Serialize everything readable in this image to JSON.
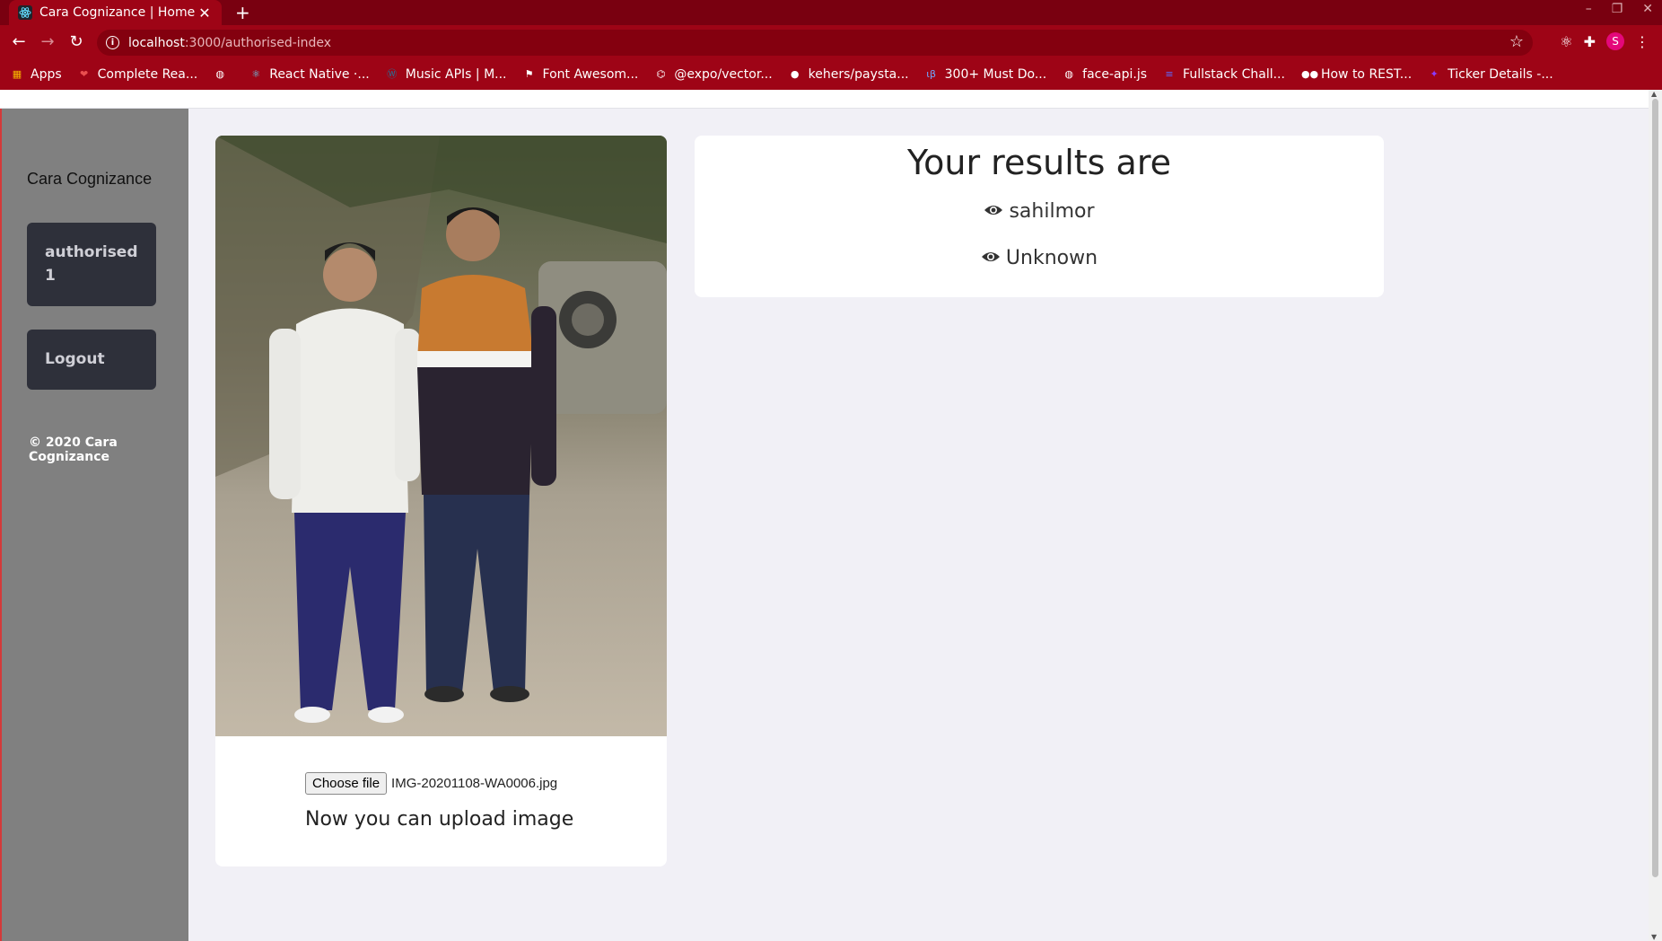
{
  "browser": {
    "tab_title": "Cara Cognizance | Home",
    "url_host": "localhost",
    "url_path": ":3000/authorised-index",
    "profile_initial": "S",
    "bookmarks": [
      {
        "label": "Apps",
        "icon": "apps-grid-icon",
        "color": "#f4b400"
      },
      {
        "label": "Complete Rea...",
        "icon": "bookmark-icon",
        "color": "#e94f4f"
      },
      {
        "label": "",
        "icon": "globe-icon",
        "color": "#ffffff"
      },
      {
        "label": "React Native ·...",
        "icon": "react-icon",
        "color": "#61dafb"
      },
      {
        "label": "Music APIs | M...",
        "icon": "wordpress-icon",
        "color": "#21759b"
      },
      {
        "label": "Font Awesom...",
        "icon": "flag-icon",
        "color": "#ffffff"
      },
      {
        "label": "@expo/vector...",
        "icon": "expo-icon",
        "color": "#ffffff"
      },
      {
        "label": "kehers/paysta...",
        "icon": "github-icon",
        "color": "#ffffff"
      },
      {
        "label": "300+ Must Do...",
        "icon": "ib-icon",
        "color": "#6fa8ff"
      },
      {
        "label": "face-api.js",
        "icon": "globe-icon",
        "color": "#ffffff"
      },
      {
        "label": "Fullstack Chall...",
        "icon": "doc-icon",
        "color": "#5b6bff"
      },
      {
        "label": "How to REST...",
        "icon": "medium-icon",
        "color": "#ffffff"
      },
      {
        "label": "Ticker Details -...",
        "icon": "bulb-icon",
        "color": "#8a3cff"
      }
    ]
  },
  "sidebar": {
    "brand": "Cara Cognizance",
    "auth_button": "authorised 1",
    "logout_button": "Logout",
    "copyright": "© 2020 Cara Cognizance"
  },
  "upload": {
    "choose_label": "Choose file",
    "file_name": "IMG-20201108-WA0006.jpg",
    "status_text": "Now you can upload image"
  },
  "results": {
    "title": "Your results are",
    "items": [
      "sahilmor",
      "Unknown"
    ]
  },
  "colors": {
    "chrome": "#9e0416",
    "sidebar": "#808080",
    "sidebar_button": "#2e303a",
    "page_bg": "#f1f0f6"
  }
}
